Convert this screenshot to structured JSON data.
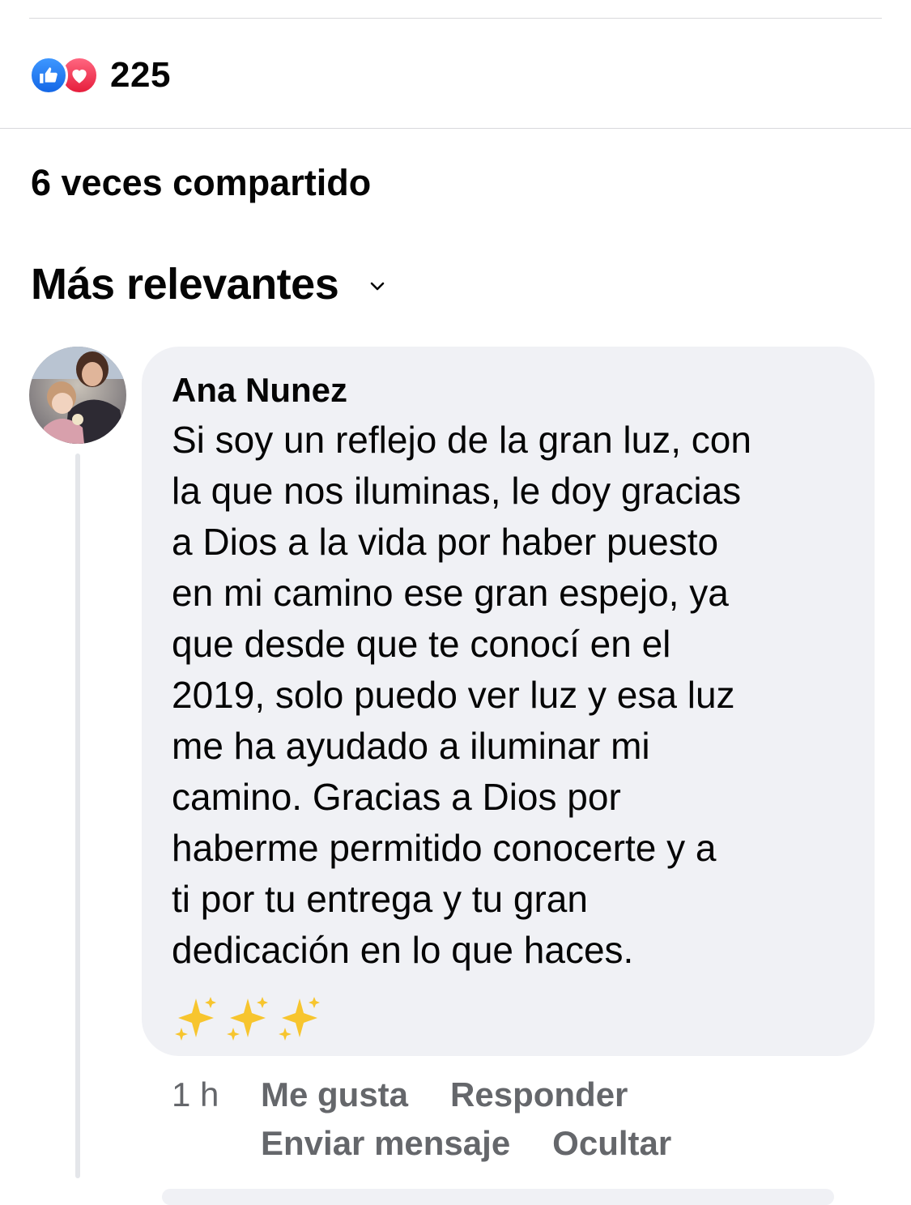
{
  "post": {
    "reaction_count": "225",
    "reaction_icons": [
      "like-icon",
      "love-icon"
    ],
    "shares_text": "6 veces compartido",
    "sort_label": "Más relevantes"
  },
  "comment": {
    "author": "Ana Nunez",
    "text": "Si soy un reflejo de la gran luz, con\nla que nos iluminas, le doy gracias\na Dios a la vida por haber puesto\nen mi camino ese gran espejo, ya\nque desde que te conocí en el\n2019, solo puedo ver luz y esa luz\nme ha ayudado a iluminar mi\ncamino. Gracias a Dios por\nhaberme permitido conocerte y a\nti por tu entrega y tu gran\ndedicación en lo que haces.",
    "emoji": "✨✨✨",
    "time": "1 h",
    "actions": {
      "like": "Me gusta",
      "reply": "Responder",
      "message": "Enviar mensaje",
      "hide": "Ocultar"
    }
  },
  "colors": {
    "like_blue": "#1877f2",
    "love_red": "#f33e58",
    "bubble_bg": "#f0f1f5",
    "meta_gray": "#65676b"
  }
}
